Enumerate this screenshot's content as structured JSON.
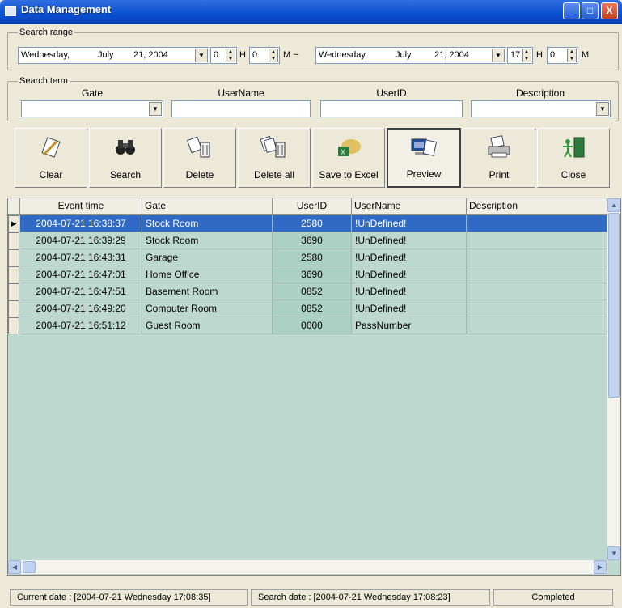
{
  "window": {
    "title": "Data Management",
    "minimize": "_",
    "maximize": "□",
    "close": "X"
  },
  "search_range": {
    "label": "Search range",
    "start_date": {
      "day": "Wednesday,",
      "month": "July",
      "date": "21, 2004"
    },
    "start_hour": "0",
    "hour_unit": "H",
    "start_minute": "0",
    "minute_unit_tilde": "M ~",
    "end_date": {
      "day": "Wednesday,",
      "month": "July",
      "date": "21, 2004"
    },
    "end_hour": "17",
    "end_minute": "0",
    "minute_unit": "M"
  },
  "search_term": {
    "label": "Search term",
    "gate_label": "Gate",
    "username_label": "UserName",
    "userid_label": "UserID",
    "description_label": "Description",
    "gate_value": "",
    "username_value": "",
    "userid_value": "",
    "description_value": ""
  },
  "toolbar": {
    "clear": "Clear",
    "search": "Search",
    "delete": "Delete",
    "delete_all": "Delete all",
    "save_excel": "Save to Excel",
    "preview": "Preview",
    "print": "Print",
    "close": "Close"
  },
  "icons": {
    "clear": "clear-icon",
    "search": "binoculars-icon",
    "delete": "trash-icon",
    "delete_all": "trash-all-icon",
    "save_excel": "excel-icon",
    "preview": "preview-icon",
    "print": "printer-icon",
    "close": "exit-door-icon"
  },
  "grid": {
    "columns": [
      "Event time",
      "Gate",
      "UserID",
      "UserName",
      "Description"
    ],
    "rows": [
      {
        "time": "2004-07-21 16:38:37",
        "gate": "Stock Room",
        "userid": "2580",
        "username": "!UnDefined!",
        "description": ""
      },
      {
        "time": "2004-07-21 16:39:29",
        "gate": "Stock Room",
        "userid": "3690",
        "username": "!UnDefined!",
        "description": ""
      },
      {
        "time": "2004-07-21 16:43:31",
        "gate": "Garage",
        "userid": "2580",
        "username": "!UnDefined!",
        "description": ""
      },
      {
        "time": "2004-07-21 16:47:01",
        "gate": "Home Office",
        "userid": "3690",
        "username": "!UnDefined!",
        "description": ""
      },
      {
        "time": "2004-07-21 16:47:51",
        "gate": "Basement Room",
        "userid": "0852",
        "username": "!UnDefined!",
        "description": ""
      },
      {
        "time": "2004-07-21 16:49:20",
        "gate": "Computer Room",
        "userid": "0852",
        "username": "!UnDefined!",
        "description": ""
      },
      {
        "time": "2004-07-21 16:51:12",
        "gate": "Guest Room",
        "userid": "0000",
        "username": "PassNumber",
        "description": ""
      }
    ],
    "selected_row": 0
  },
  "status": {
    "current": "Current date : [2004-07-21 Wednesday 17:08:35]",
    "search": "Search date : [2004-07-21 Wednesday 17:08:23]",
    "state": "Completed"
  },
  "colors": {
    "selection": "#316ac5",
    "grid_bg": "#bcd8cf",
    "title_bar": "#0a4fd0"
  }
}
